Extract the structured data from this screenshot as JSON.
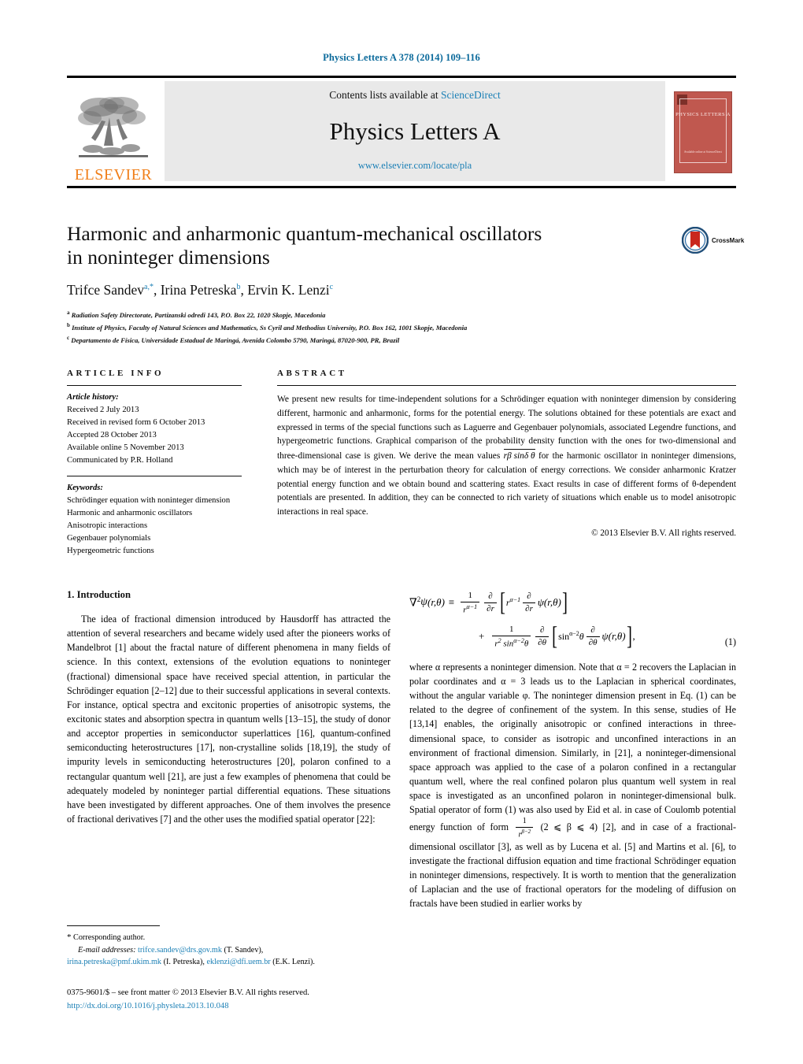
{
  "running_head": "Physics Letters A 378 (2014) 109–116",
  "masthead": {
    "publisher_word": "ELSEVIER",
    "contents_prefix": "Contents lists available at ",
    "contents_link": "ScienceDirect",
    "journal_title": "Physics Letters A",
    "journal_url": "www.elsevier.com/locate/pla",
    "cover_title": "PHYSICS LETTERS A",
    "cover_sub": "Available online at\nScienceDirect"
  },
  "article": {
    "title_line1": "Harmonic and anharmonic quantum-mechanical oscillators",
    "title_line2": "in noninteger dimensions",
    "authors": [
      {
        "name": "Trifce Sandev",
        "marks": "a,*"
      },
      {
        "name": "Irina Petreska",
        "marks": "b"
      },
      {
        "name": "Ervin K. Lenzi",
        "marks": "c"
      }
    ],
    "affiliations": [
      {
        "mark": "a",
        "text": "Radiation Safety Directorate, Partizanski odredi 143, P.O. Box 22, 1020 Skopje, Macedonia"
      },
      {
        "mark": "b",
        "text": "Institute of Physics, Faculty of Natural Sciences and Mathematics, Ss Cyril and Methodius University, P.O. Box 162, 1001 Skopje, Macedonia"
      },
      {
        "mark": "c",
        "text": "Departamento de Física, Universidade Estadual de Maringá, Avenida Colombo 5790, Maringá, 87020-900, PR, Brazil"
      }
    ],
    "crossmark_label": "CrossMark"
  },
  "article_info": {
    "heading": "ARTICLE INFO",
    "history_label": "Article history:",
    "history": [
      "Received 2 July 2013",
      "Received in revised form 6 October 2013",
      "Accepted 28 October 2013",
      "Available online 5 November 2013",
      "Communicated by P.R. Holland"
    ],
    "keywords_label": "Keywords:",
    "keywords": [
      "Schrödinger equation with noninteger dimension",
      "Harmonic and anharmonic oscillators",
      "Anisotropic interactions",
      "Gegenbauer polynomials",
      "Hypergeometric functions"
    ]
  },
  "abstract": {
    "heading": "ABSTRACT",
    "part1": "We present new results for time-independent solutions for a Schrödinger equation with noninteger dimension by considering different, harmonic and anharmonic, forms for the potential energy. The solutions obtained for these potentials are exact and expressed in terms of the special functions such as Laguerre and Gegenbauer polynomials, associated Legendre functions, and hypergeometric functions. Graphical comparison of the probability density function with the ones for two-dimensional and three-dimensional case is given. We derive the mean values ",
    "mean_value_expr": "rβ sinδ θ",
    "part2": " for the harmonic oscillator in noninteger dimensions, which may be of interest in the perturbation theory for calculation of energy corrections. We consider anharmonic Kratzer potential energy function and we obtain bound and scattering states. Exact results in case of different forms of θ-dependent potentials are presented. In addition, they can be connected to rich variety of situations which enable us to model anisotropic interactions in real space.",
    "copyright": "© 2013 Elsevier B.V. All rights reserved."
  },
  "body": {
    "section1_heading": "1. Introduction",
    "left_paragraph": "The idea of fractional dimension introduced by Hausdorff has attracted the attention of several researchers and became widely used after the pioneers works of Mandelbrot [1] about the fractal nature of different phenomena in many fields of science. In this context, extensions of the evolution equations to noninteger (fractional) dimensional space have received special attention, in particular the Schrödinger equation [2–12] due to their successful applications in several contexts. For instance, optical spectra and excitonic properties of anisotropic systems, the excitonic states and absorption spectra in quantum wells [13–15], the study of donor and acceptor properties in semiconductor superlattices [16], quantum-confined semiconducting heterostructures [17], non-crystalline solids [18,19], the study of impurity levels in semiconducting heterostructures [20], polaron confined to a rectangular quantum well [21], are just a few examples of phenomena that could be adequately modeled by noninteger partial differential equations. These situations have been investigated by different approaches. One of them involves the presence of fractional derivatives [7] and the other uses the modified spatial operator [22]:",
    "equation_number": "(1)",
    "right_paragraph": "where α represents a noninteger dimension. Note that α = 2 recovers the Laplacian in polar coordinates and α = 3 leads us to the Laplacian in spherical coordinates, without the angular variable φ. The noninteger dimension present in Eq. (1) can be related to the degree of confinement of the system. In this sense, studies of He [13,14] enables, the originally anisotropic or confined interactions in three-dimensional space, to consider as isotropic and unconfined interactions in an environment of fractional dimension. Similarly, in [21], a noninteger-dimensional space approach was applied to the case of a polaron confined in a rectangular quantum well, where the real confined polaron plus quantum well system in real space is investigated as an unconfined polaron in noninteger-dimensional bulk. Spatial operator of form (1) was also used by Eid et al. in case of Coulomb potential energy function of form",
    "right_fraction": "1/r^(β−2)",
    "right_paragraph_cont": "(2 ⩽ β ⩽ 4) [2], and in case of a fractional-dimensional oscillator [3], as well as by Lucena et al. [5] and Martins et al. [6], to investigate the fractional diffusion equation and time fractional Schrödinger equation in noninteger dimensions, respectively. It is worth to mention that the generalization of Laplacian and the use of fractional operators for the modeling of diffusion on fractals have been studied in earlier works by"
  },
  "footnote": {
    "star": "*",
    "corresponding": "Corresponding author.",
    "email_label": "E-mail addresses:",
    "emails": [
      {
        "address": "trifce.sandev@drs.gov.mk",
        "who": "(T. Sandev),"
      },
      {
        "address": "irina.petreska@pmf.ukim.mk",
        "who": "(I. Petreska),"
      },
      {
        "address": "eklenzi@dfi.uem.br",
        "who": "(E.K. Lenzi)."
      }
    ]
  },
  "imprint": {
    "line1": "0375-9601/$ – see front matter © 2013 Elsevier B.V. All rights reserved.",
    "doi": "http://dx.doi.org/10.1016/j.physleta.2013.10.048"
  },
  "colors": {
    "link_blue": "#1a7fb5",
    "runhead_blue": "#0b6a9b",
    "elsevier_orange": "#f07f1a",
    "cover_red": "#c0584f",
    "band_gray": "#e9e9e9"
  }
}
